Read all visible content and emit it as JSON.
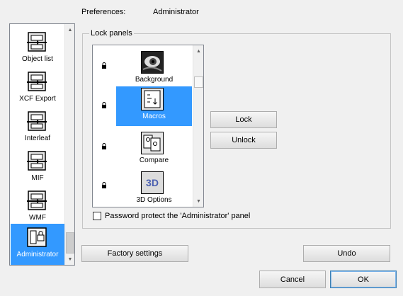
{
  "header": {
    "prefs_label": "Preferences:",
    "section_title": "Administrator"
  },
  "sidebar": {
    "items": [
      {
        "label": "Object list",
        "icon": "object-list-icon"
      },
      {
        "label": "XCF Export",
        "icon": "xcf-export-icon"
      },
      {
        "label": "Interleaf",
        "icon": "interleaf-icon"
      },
      {
        "label": "MIF",
        "icon": "mif-icon"
      },
      {
        "label": "WMF",
        "icon": "wmf-icon"
      },
      {
        "label": "Administrator",
        "icon": "administrator-icon",
        "selected": true
      }
    ]
  },
  "lock_panels": {
    "title": "Lock panels",
    "items": [
      {
        "label": "Background",
        "icon": "background-icon",
        "locked": true
      },
      {
        "label": "Macros",
        "icon": "macros-icon",
        "locked": true,
        "selected": true
      },
      {
        "label": "Compare",
        "icon": "compare-icon",
        "locked": true
      },
      {
        "label": "3D Options",
        "icon": "3d-options-icon",
        "icon_text": "3D",
        "locked": true
      }
    ],
    "lock_button": "Lock",
    "unlock_button": "Unlock",
    "password_checkbox": {
      "label": "Password protect the 'Administrator' panel",
      "checked": false
    }
  },
  "buttons": {
    "factory_settings": "Factory settings",
    "undo": "Undo",
    "cancel": "Cancel",
    "ok": "OK"
  },
  "colors": {
    "selection": "#3399ff",
    "window_bg": "#f0f0f0"
  }
}
